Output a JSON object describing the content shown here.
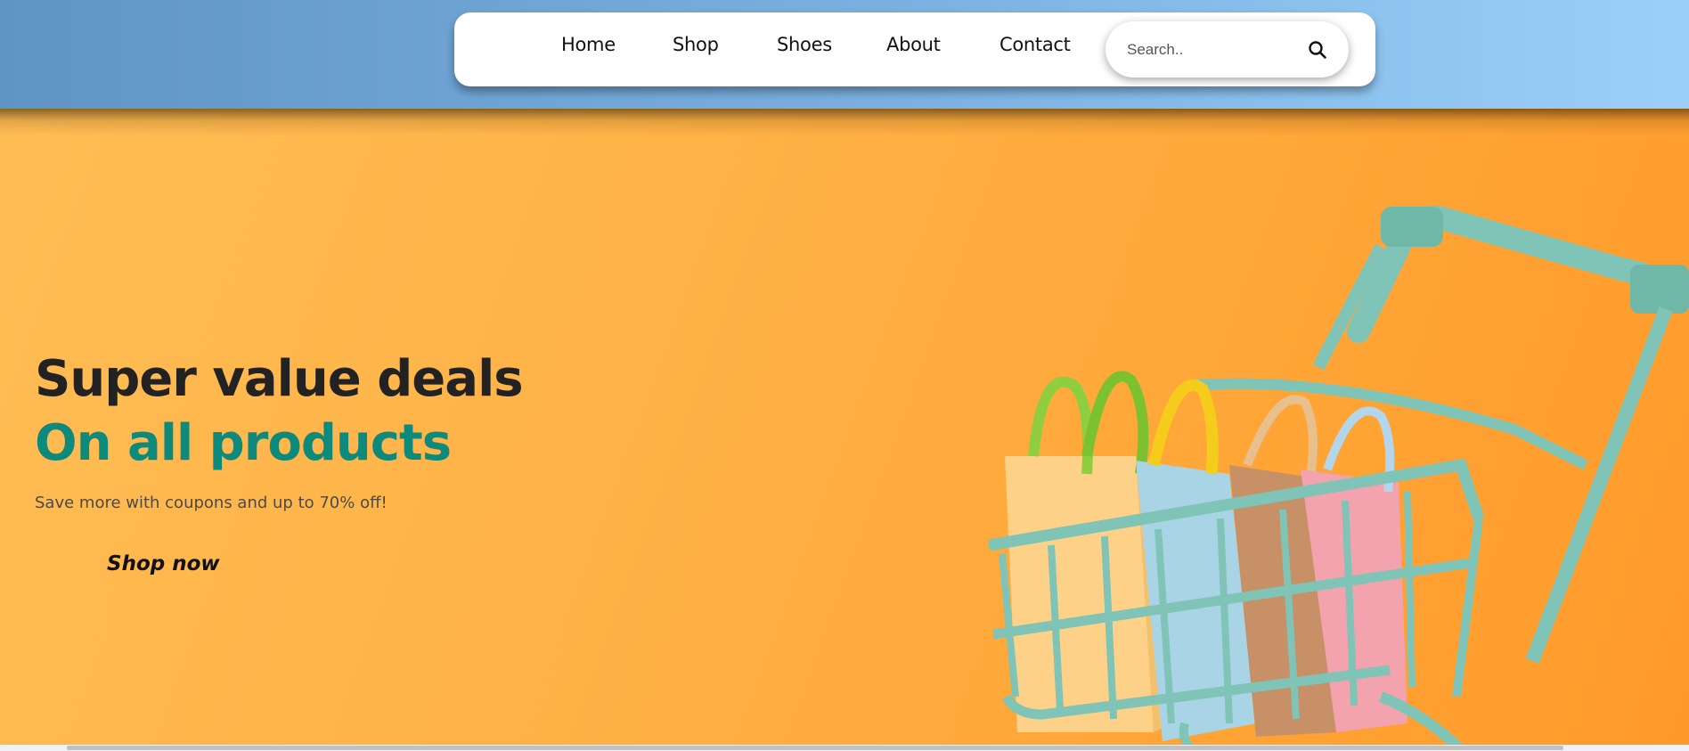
{
  "nav": {
    "links": [
      "Home",
      "Shop",
      "Shoes",
      "About",
      "Contact"
    ],
    "search_placeholder": "Search..",
    "search_icon": "search-icon"
  },
  "hero": {
    "headline_line1": "Super value deals",
    "headline_line2": "On all products",
    "subtext": "Save more with coupons and up to 70% off!",
    "cta_label": "Shop now",
    "image": "shopping-cart-with-bags-illustration"
  },
  "colors": {
    "header_gradient_start": "#5f95c5",
    "header_gradient_end": "#9bd0f8",
    "hero_background": "#ffb347",
    "accent_teal": "#0e8a7c",
    "cart_teal": "#7fc4b6"
  }
}
